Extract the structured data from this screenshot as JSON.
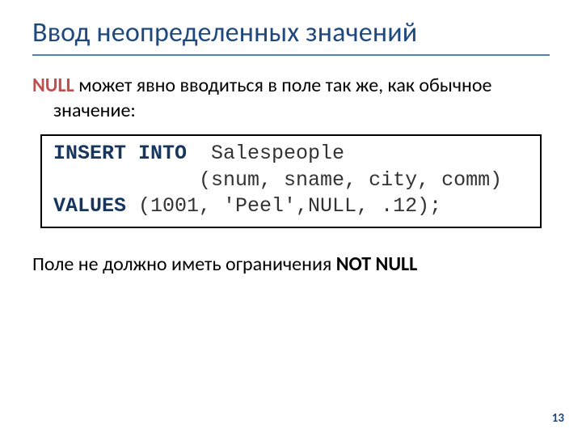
{
  "title": "Ввод неопределенных значений",
  "intro": {
    "null_kw": "NULL",
    "rest": " может явно вводиться в поле так же, как обычное значение:"
  },
  "code": {
    "kw_insert_into": "INSERT INTO",
    "tail1": "  Salespeople",
    "line2": "            (snum, sname, city, comm)",
    "kw_values": "VALUES",
    "tail3": " (1001, 'Peel',NULL, .12);"
  },
  "note": {
    "lead": "Поле не должно иметь ограничения ",
    "not_null": "NOT NULL"
  },
  "page_number": "13"
}
